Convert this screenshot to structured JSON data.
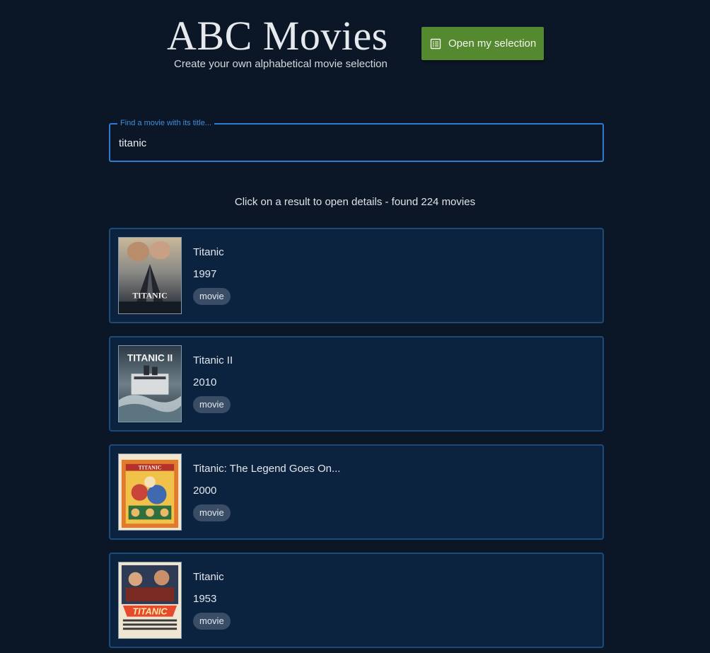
{
  "header": {
    "title": "ABC Movies",
    "subtitle": "Create your own alphabetical movie selection",
    "open_selection_label": "Open my selection",
    "open_selection_icon": "list-icon",
    "button_color": "#54892f"
  },
  "search": {
    "label": "Find a movie with its title...",
    "value": "titanic",
    "accent_color": "#2f7bd3"
  },
  "results": {
    "info": "Click on a result to open details - found 224 movies",
    "items": [
      {
        "title": "Titanic",
        "year": "1997",
        "type": "movie",
        "poster_text": "TITANIC"
      },
      {
        "title": "Titanic II",
        "year": "2010",
        "type": "movie",
        "poster_text": "TITANIC II"
      },
      {
        "title": "Titanic: The Legend Goes On...",
        "year": "2000",
        "type": "movie",
        "poster_text": "TITANIC"
      },
      {
        "title": "Titanic",
        "year": "1953",
        "type": "movie",
        "poster_text": "TITANIC"
      }
    ]
  }
}
